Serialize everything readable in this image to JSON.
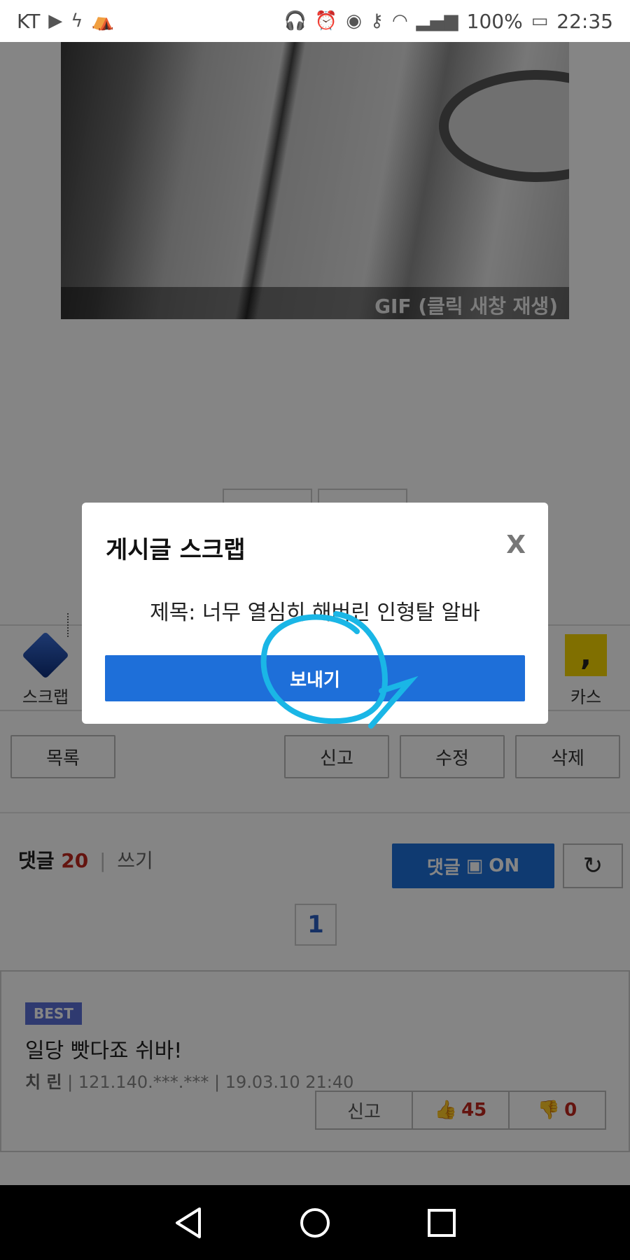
{
  "status_bar": {
    "carrier": "KT",
    "battery": "100%",
    "time": "22:35",
    "icons": [
      "youtube-icon",
      "app-icon",
      "tent-icon",
      "headset-icon",
      "alarm-icon",
      "eye-icon",
      "key-icon",
      "wifi-icon",
      "signal-icon",
      "battery-icon"
    ]
  },
  "gif": {
    "caption": "GIF (클릭 새창 재생)"
  },
  "share": {
    "scrap_label": "스크랩",
    "kakao_label": "카스",
    "kakao_glyph": ","
  },
  "actions": {
    "list": "목록",
    "report": "신고",
    "edit": "수정",
    "delete": "삭제"
  },
  "comments": {
    "label": "댓글",
    "count": "20",
    "separator": "|",
    "write": "쓰기",
    "toggle_label": "댓글",
    "toggle_state": "ON",
    "refresh_icon": "refresh-icon",
    "page": "1"
  },
  "best_comment": {
    "badge": "BEST",
    "text": "일당 빳다죠 쉬바!",
    "author": "치 린",
    "meta": " | 121.140.***.*** | 19.03.10 21:40",
    "report": "신고",
    "likes": "45",
    "dislikes": "0"
  },
  "modal": {
    "title": "게시글 스크랩",
    "close": "X",
    "subject": "제목: 너무 열심히 해버린 인형탈 알바",
    "send": "보내기"
  },
  "colors": {
    "accent_blue": "#1e6fd9",
    "annotation_cyan": "#1ab6e6",
    "count_red": "#c0281e"
  }
}
